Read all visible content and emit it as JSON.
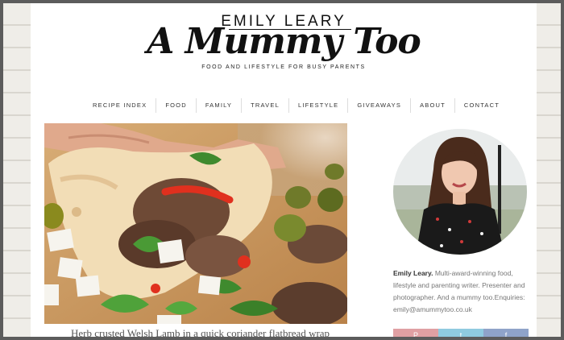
{
  "site": {
    "name_top": "EMILY LEARY",
    "name_script": "A Mummy Too",
    "tagline": "FOOD AND LIFESTYLE FOR BUSY PARENTS"
  },
  "nav": {
    "items": [
      "RECIPE INDEX",
      "FOOD",
      "FAMILY",
      "TRAVEL",
      "LIFESTYLE",
      "GIVEAWAYS",
      "ABOUT",
      "CONTACT"
    ]
  },
  "post": {
    "caption": "Herb crusted Welsh Lamb in a quick coriander flatbread wrap"
  },
  "sidebar": {
    "bio_name": "Emily Leary.",
    "bio_text": " Multi-award-winning food, lifestyle and parenting writer. Presenter and photographer. And a mummy too.Enquiries: emily@amummytoo.co.uk"
  },
  "social": {
    "items": [
      {
        "icon": "pinterest-icon",
        "glyph": "P",
        "color": "#e0a0a3"
      },
      {
        "icon": "twitter-icon",
        "glyph": "t",
        "color": "#8fcbe0"
      },
      {
        "icon": "facebook-icon",
        "glyph": "f",
        "color": "#8fa3c9"
      }
    ]
  },
  "colors": {
    "page_bg": "#ffffff",
    "backdrop": "#efede8",
    "text": "#111111",
    "muted": "#777777"
  }
}
